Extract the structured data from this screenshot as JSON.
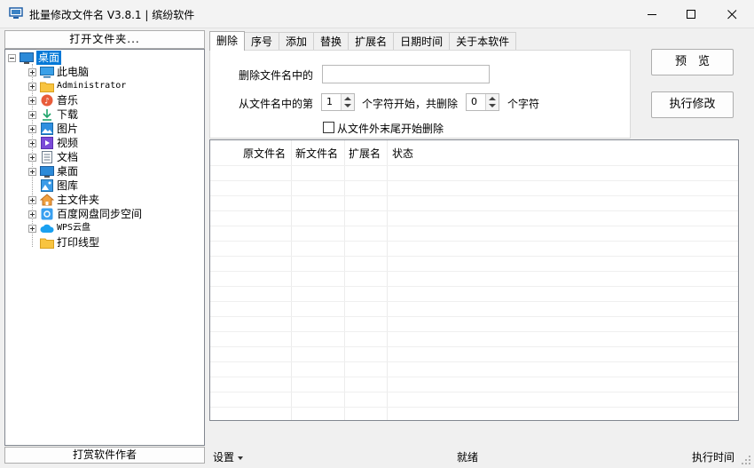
{
  "window": {
    "title": "批量修改文件名 V3.8.1 | 缤纷软件"
  },
  "left_panel": {
    "open_folder_label": "打开文件夹...",
    "donate_label": "打赏软件作者",
    "tree": {
      "root": {
        "label": "桌面",
        "icon": "desktop-icon",
        "selected": true
      },
      "items": [
        {
          "label": "此电脑",
          "icon": "monitor-icon",
          "expandable": true
        },
        {
          "label": "Administrator",
          "icon": "folder-icon",
          "expandable": true
        },
        {
          "label": "音乐",
          "icon": "music-icon",
          "expandable": true
        },
        {
          "label": "下载",
          "icon": "download-icon",
          "expandable": true
        },
        {
          "label": "图片",
          "icon": "picture-icon",
          "expandable": true
        },
        {
          "label": "视频",
          "icon": "video-icon",
          "expandable": true
        },
        {
          "label": "文档",
          "icon": "document-icon",
          "expandable": true
        },
        {
          "label": "桌面",
          "icon": "desktop-icon",
          "expandable": true
        },
        {
          "label": "图库",
          "icon": "gallery-icon",
          "expandable": false
        },
        {
          "label": "主文件夹",
          "icon": "home-icon",
          "expandable": true
        },
        {
          "label": "百度网盘同步空间",
          "icon": "cloud-sync-icon",
          "expandable": true
        },
        {
          "label": "WPS云盘",
          "icon": "cloud-icon",
          "expandable": true
        },
        {
          "label": "打印线型",
          "icon": "folder-icon",
          "expandable": false
        }
      ]
    }
  },
  "tabs": [
    {
      "label": "删除",
      "active": true
    },
    {
      "label": "序号",
      "active": false
    },
    {
      "label": "添加",
      "active": false
    },
    {
      "label": "替换",
      "active": false
    },
    {
      "label": "扩展名",
      "active": false
    },
    {
      "label": "日期时间",
      "active": false
    },
    {
      "label": "关于本软件",
      "active": false
    }
  ],
  "delete_tab": {
    "delete_text_label": "删除文件名中的",
    "delete_text_value": "",
    "from_label": "从文件名中的第",
    "start_value": "1",
    "start_suffix": "个字符开始，共删除",
    "count_value": "0",
    "count_suffix": "个字符",
    "from_end_label": "从文件外末尾开始删除",
    "from_end_checked": false
  },
  "actions": {
    "preview_label": "预　览",
    "execute_label": "执行修改"
  },
  "grid": {
    "columns": [
      "原文件名",
      "新文件名",
      "扩展名",
      "状态"
    ],
    "rows": []
  },
  "statusbar": {
    "settings_label": "设置",
    "status_text": "就绪",
    "exec_time_label": "执行时间"
  },
  "colors": {
    "selection": "#0078d7",
    "window_bg": "#f0f0f0"
  }
}
